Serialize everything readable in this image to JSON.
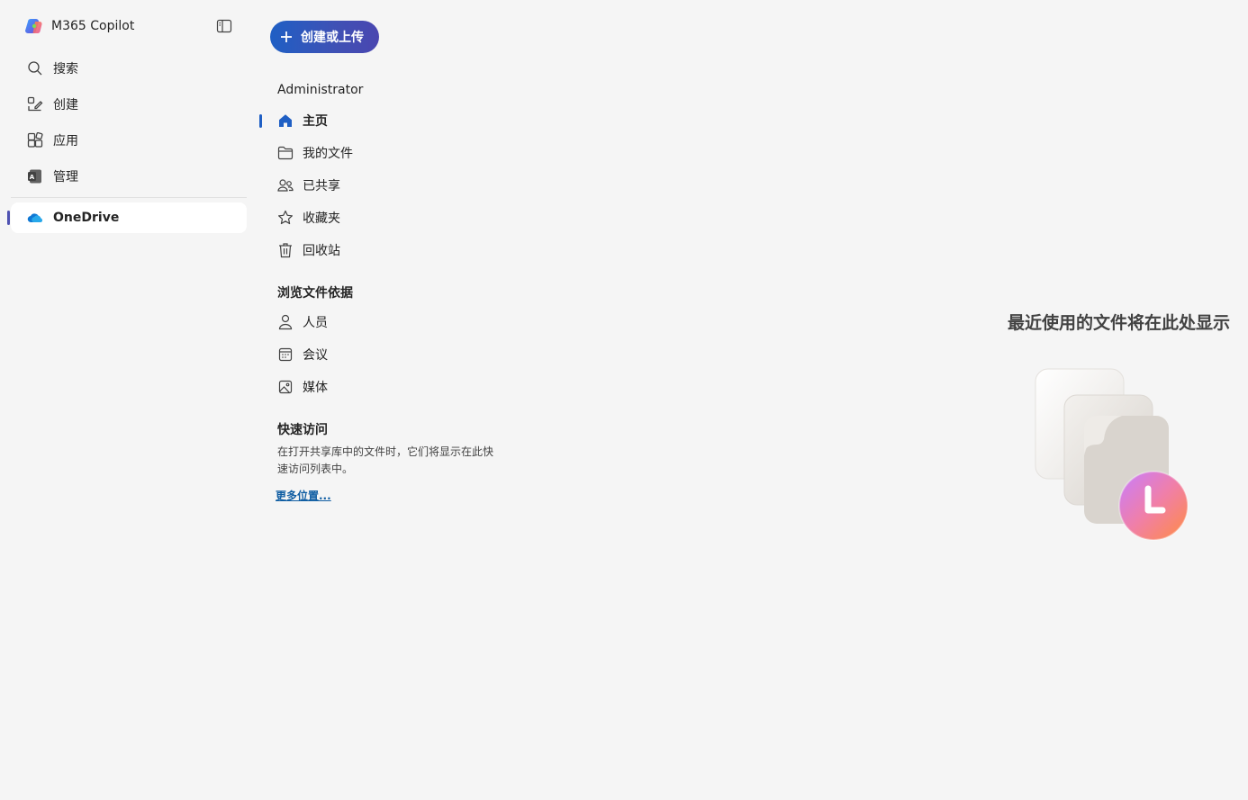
{
  "app": {
    "title": "M365 Copilot"
  },
  "rail": {
    "items": [
      {
        "label": "搜索",
        "icon": "search-icon"
      },
      {
        "label": "创建",
        "icon": "create-icon"
      },
      {
        "label": "应用",
        "icon": "apps-icon"
      },
      {
        "label": "管理",
        "icon": "admin-icon"
      }
    ],
    "active_app": {
      "label": "OneDrive",
      "icon": "onedrive-icon"
    }
  },
  "nav": {
    "create_label": "创建或上传",
    "account_title": "Administrator",
    "items": [
      {
        "label": "主页",
        "icon": "home-icon"
      },
      {
        "label": "我的文件",
        "icon": "folder-icon"
      },
      {
        "label": "已共享",
        "icon": "people-icon"
      },
      {
        "label": "收藏夹",
        "icon": "star-icon"
      },
      {
        "label": "回收站",
        "icon": "trash-icon"
      }
    ],
    "browse_title": "浏览文件依据",
    "browse_items": [
      {
        "label": "人员",
        "icon": "person-icon"
      },
      {
        "label": "会议",
        "icon": "calendar-icon"
      },
      {
        "label": "媒体",
        "icon": "image-icon"
      }
    ],
    "quick_access_title": "快速访问",
    "quick_access_desc": "在打开共享库中的文件时，它们将显示在此快速访问列表中。",
    "more_places": "更多位置..."
  },
  "main": {
    "empty_heading": "最近使用的文件将在此处显示"
  },
  "colors": {
    "accent": "#1f5fc4",
    "rail_indicator": "#4f52b2",
    "background": "#f5f5f5"
  }
}
